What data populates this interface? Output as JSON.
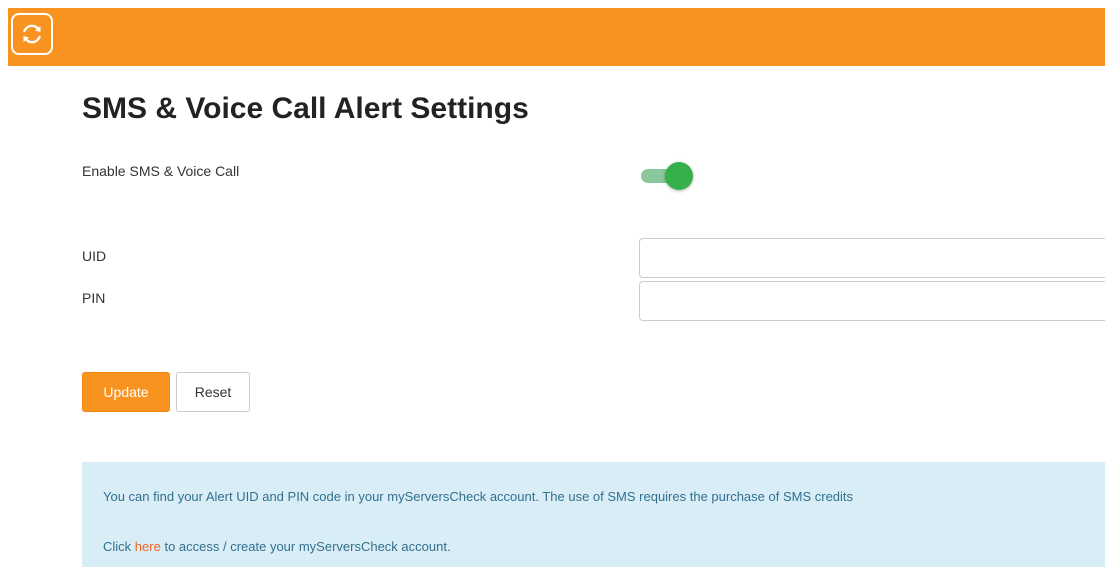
{
  "header": {
    "brand_color": "#f7931e",
    "logo_icon": "refresh-icon"
  },
  "page_title": "SMS & Voice Call Alert Settings",
  "enable": {
    "label": "Enable SMS & Voice Call",
    "state": "on",
    "on_color": "#35b04a"
  },
  "fields": {
    "uid_label": "UID",
    "uid_value": "",
    "pin_label": "PIN",
    "pin_value": ""
  },
  "buttons": {
    "update_label": "Update",
    "reset_label": "Reset"
  },
  "info": {
    "line1": "You can find your Alert UID and PIN code in your myServersCheck account. The use of SMS requires the purchase of SMS credits",
    "line2_prefix": "Click",
    "line2_link": "here",
    "line2_suffix": "to access / create your myServersCheck account."
  }
}
